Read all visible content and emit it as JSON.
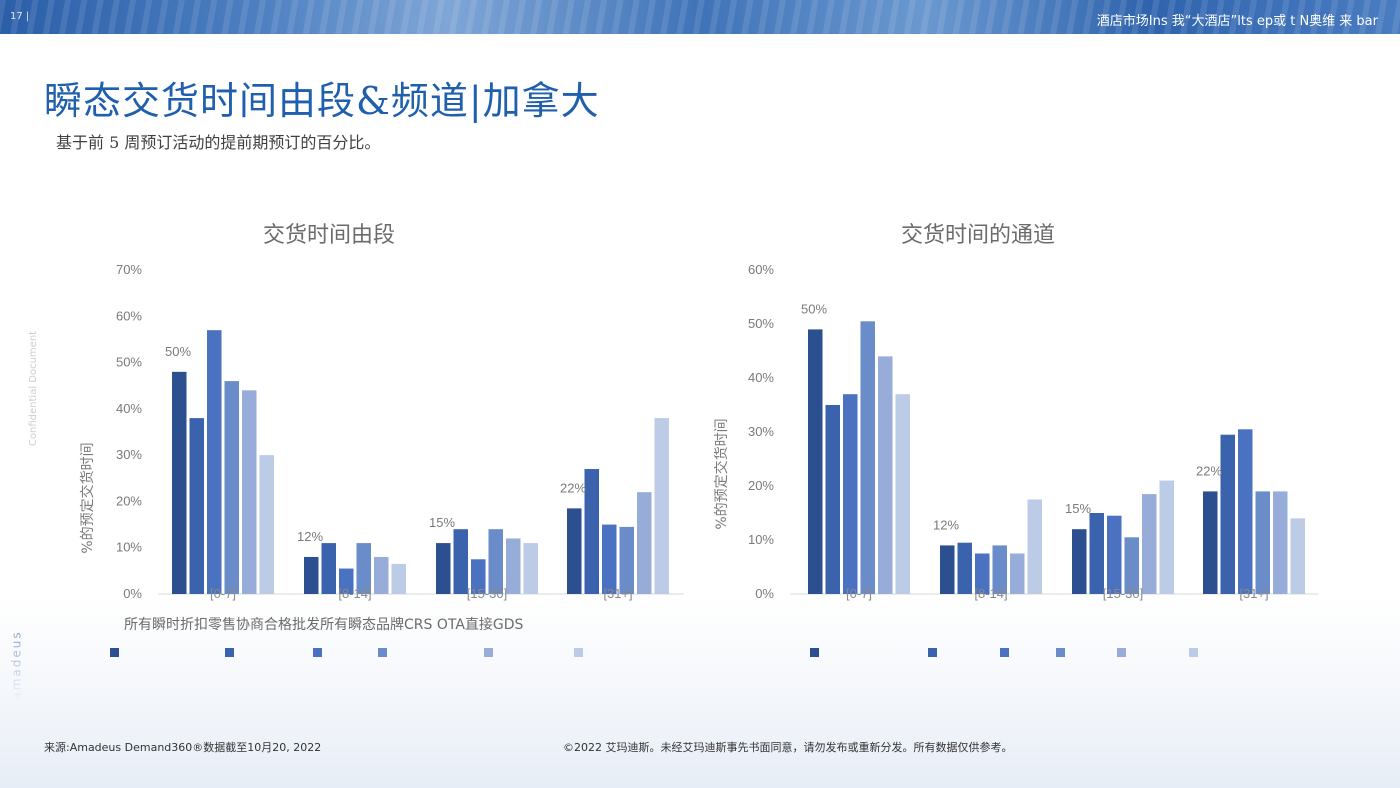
{
  "page_number": "17 |",
  "header_text": "酒店市场Ins 我“大酒店”lts    ep或 t    N奥维  来   bar",
  "title": "瞬态交货时间由段&频道|加拿大",
  "subtitle": "基于前 5 周预订活动的提前期预订的百分比。",
  "side_label": "Confidential Document",
  "brand": "amadeus",
  "legend_text": "所有瞬时折扣零售协商合格批发所有瞬态品牌CRS OTA直接GDS",
  "footer_source": "来源:Amadeus Demand360®数据截至10月20, 2022",
  "footer_copyright": "©2022 艾玛迪斯。未经艾玛迪斯事先书面同意，请勿发布或重新分发。所有数据仅供参考。",
  "colors": [
    "#2b4f8f",
    "#3b63ad",
    "#4a72c0",
    "#6a8cc8",
    "#97acd8",
    "#bccbe6"
  ],
  "chart_data": [
    {
      "type": "bar",
      "title": "交货时间由段",
      "ylabel": "%的预定交货时间",
      "ylim": [
        0,
        70
      ],
      "yticks": [
        "70%",
        "60%",
        "50%",
        "40%",
        "30%",
        "20%",
        "10%",
        "0%"
      ],
      "categories": [
        "[0-7]",
        "[8-14]",
        "[15-30]",
        "[31+]"
      ],
      "category_labels": [
        "50%",
        "12%",
        "15%",
        "22%"
      ],
      "series": [
        {
          "values": [
            48,
            8,
            11,
            18.5
          ]
        },
        {
          "values": [
            38,
            11,
            14,
            27
          ]
        },
        {
          "values": [
            57,
            5.5,
            7.5,
            15
          ]
        },
        {
          "values": [
            46,
            11,
            14,
            14.5
          ]
        },
        {
          "values": [
            44,
            8,
            12,
            22
          ]
        },
        {
          "values": [
            30,
            6.5,
            11,
            38
          ]
        }
      ]
    },
    {
      "type": "bar",
      "title": "交货时间的通道",
      "ylabel": "%的预定交货时间",
      "ylim": [
        0,
        60
      ],
      "yticks": [
        "60%",
        "50%",
        "40%",
        "30%",
        "20%",
        "10%",
        "0%"
      ],
      "categories": [
        "[0-7]",
        "[8-14]",
        "[15-30]",
        "[31+]"
      ],
      "category_labels": [
        "50%",
        "12%",
        "15%",
        "22%"
      ],
      "series": [
        {
          "values": [
            49,
            9,
            12,
            19
          ]
        },
        {
          "values": [
            35,
            9.5,
            15,
            29.5
          ]
        },
        {
          "values": [
            37,
            7.5,
            14.5,
            30.5
          ]
        },
        {
          "values": [
            50.5,
            9,
            10.5,
            19
          ]
        },
        {
          "values": [
            44,
            7.5,
            18.5,
            19
          ]
        },
        {
          "values": [
            37,
            17.5,
            21,
            14
          ]
        }
      ]
    }
  ]
}
